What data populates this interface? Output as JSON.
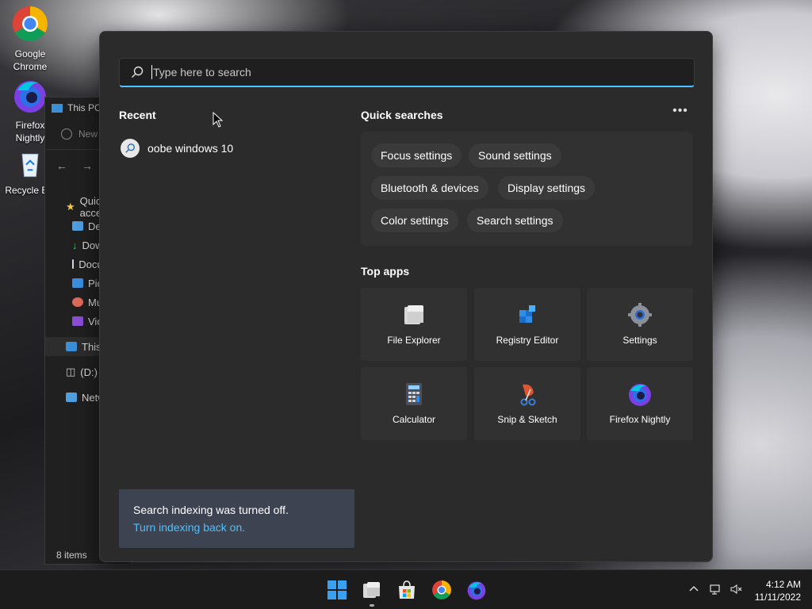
{
  "desktop": {
    "icons": [
      {
        "label": "Google Chrome",
        "icon": "chrome-icon"
      },
      {
        "label": "Firefox Nightly",
        "icon": "firefox-nightly-icon"
      },
      {
        "label": "Recycle Bin",
        "icon": "recycle-bin-icon"
      }
    ]
  },
  "explorer": {
    "title": "This PC",
    "new_label": "New",
    "nav_items": [
      "Quick access",
      "Desktop",
      "Downloads",
      "Documents",
      "Pictures",
      "Music",
      "Videos",
      "This PC",
      "(D:)",
      "Network"
    ],
    "status": "8 items"
  },
  "search": {
    "placeholder": "Type here to search"
  },
  "recent": {
    "title": "Recent",
    "items": [
      {
        "label": "oobe windows 10"
      }
    ]
  },
  "quick_searches": {
    "title": "Quick searches",
    "more_label": "•••",
    "chips": [
      "Focus settings",
      "Sound settings",
      "Bluetooth & devices",
      "Display settings",
      "Color settings",
      "Search settings"
    ]
  },
  "top_apps": {
    "title": "Top apps",
    "apps": [
      {
        "label": "File Explorer",
        "icon": "file-explorer-icon"
      },
      {
        "label": "Registry Editor",
        "icon": "registry-editor-icon"
      },
      {
        "label": "Settings",
        "icon": "settings-gear-icon"
      },
      {
        "label": "Calculator",
        "icon": "calculator-icon"
      },
      {
        "label": "Snip & Sketch",
        "icon": "snip-sketch-icon"
      },
      {
        "label": "Firefox Nightly",
        "icon": "firefox-nightly-icon"
      }
    ]
  },
  "notice": {
    "text": "Search indexing was turned off.",
    "link": "Turn indexing back on."
  },
  "taskbar": {
    "apps": [
      "windows-start-icon",
      "file-explorer-icon",
      "microsoft-store-icon",
      "chrome-icon",
      "firefox-nightly-icon"
    ],
    "time": "4:12 AM",
    "date": "11/11/2022"
  },
  "colors": {
    "accent": "#4cc2ff",
    "panel_bg": "#2b2b2b",
    "taskbar_bg": "#1c1c1c"
  }
}
